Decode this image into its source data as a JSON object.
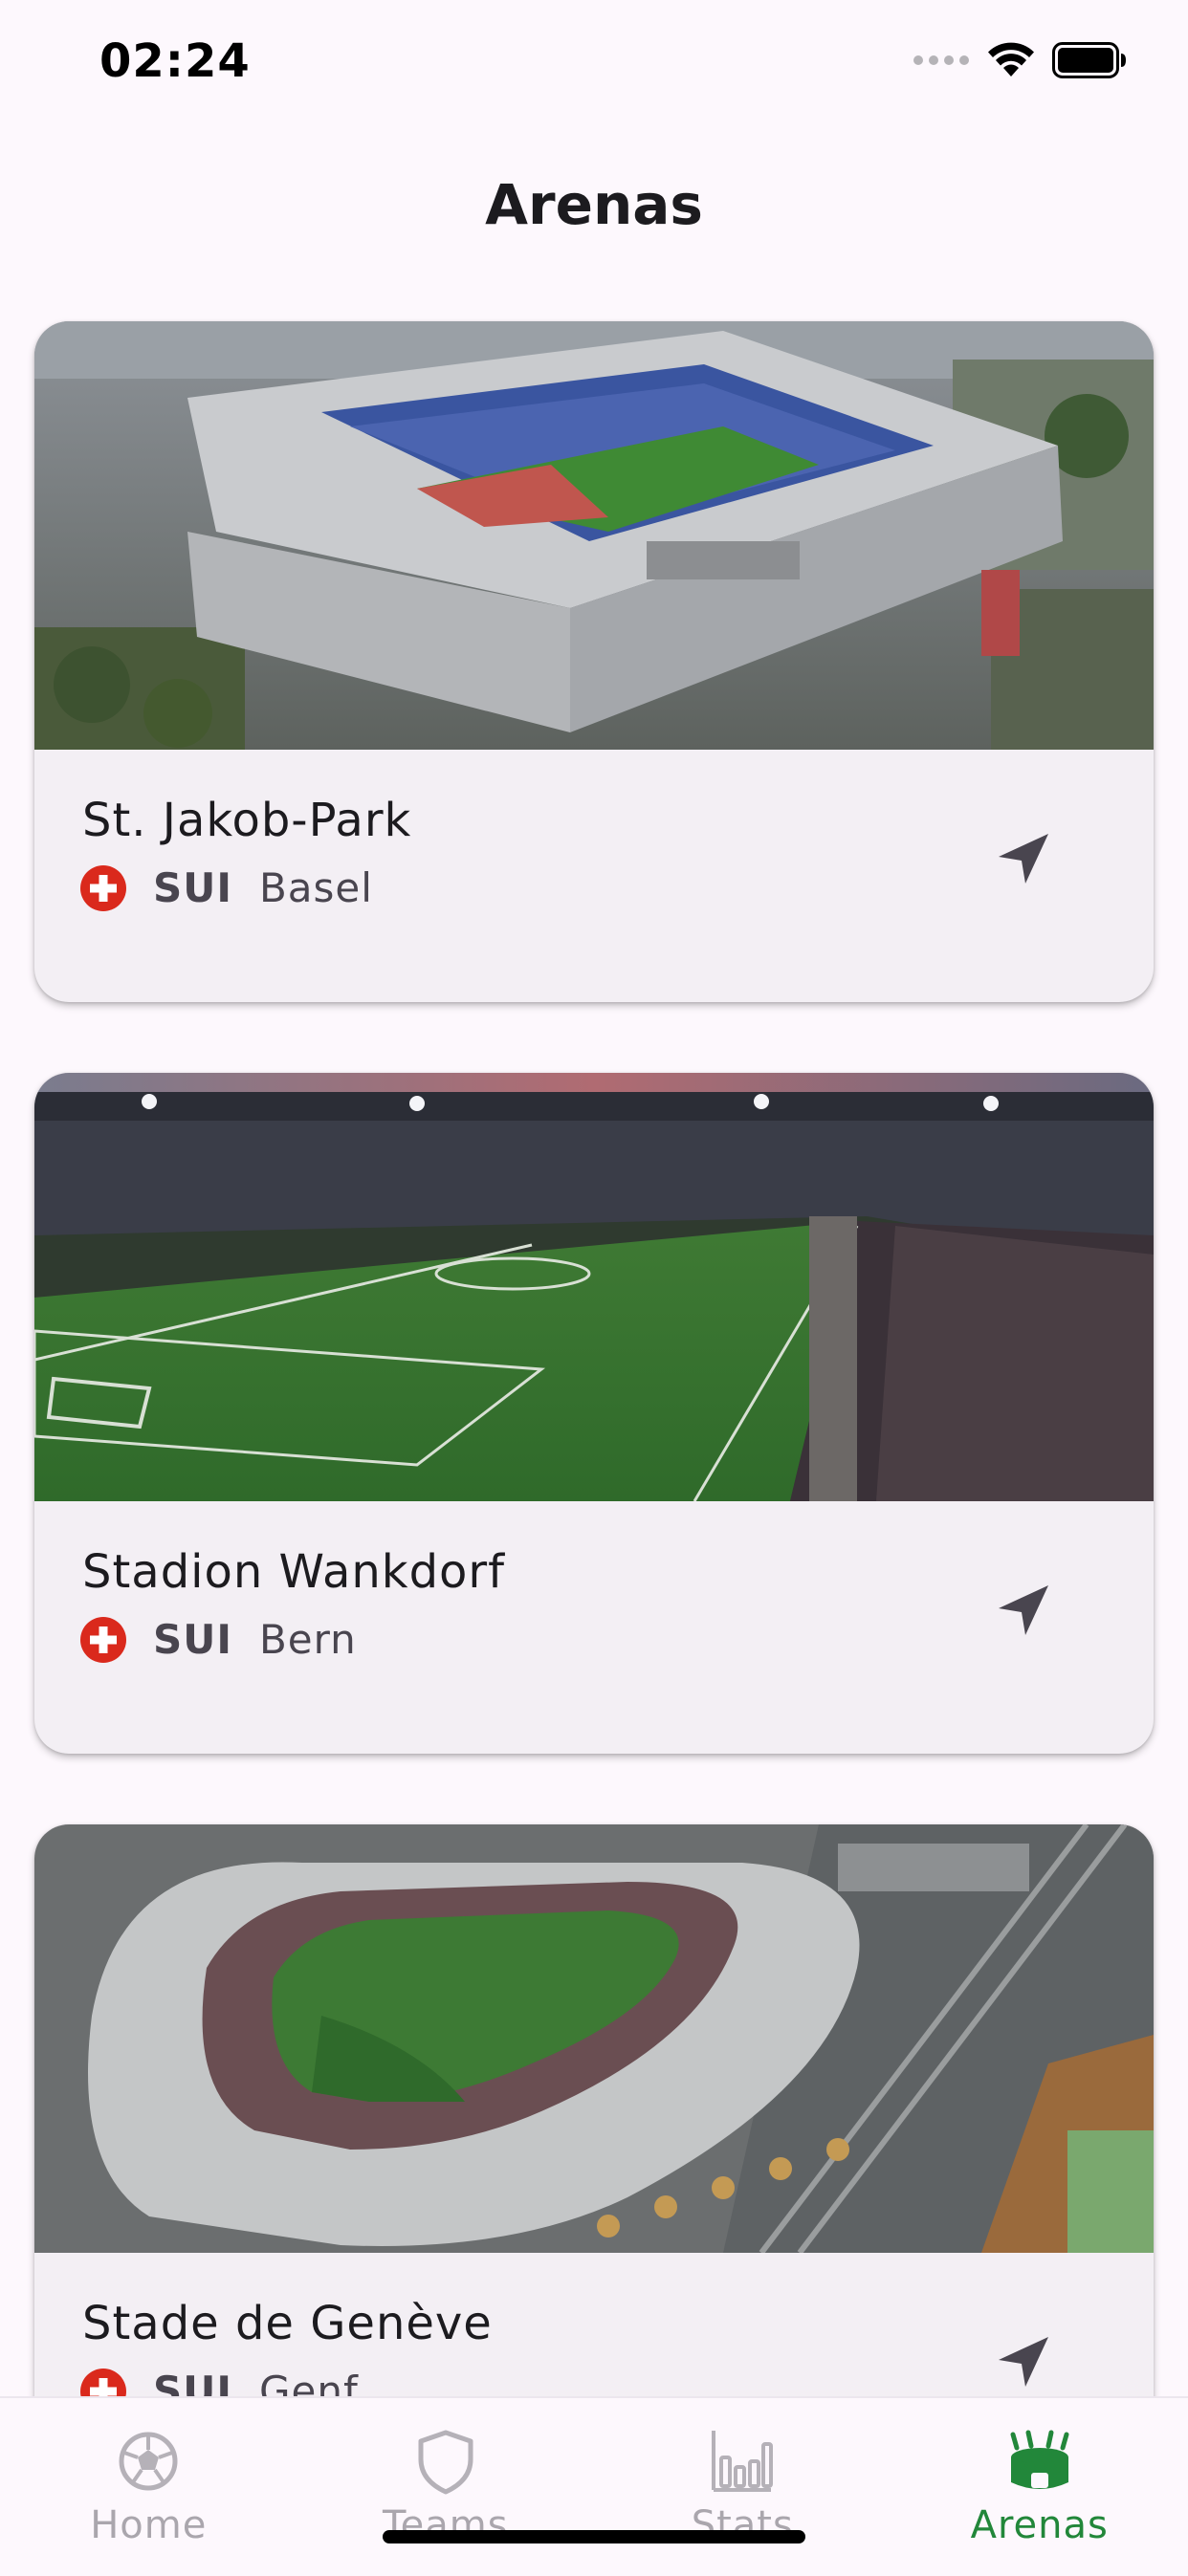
{
  "status_bar": {
    "time": "02:24"
  },
  "page": {
    "title": "Arenas"
  },
  "arenas": [
    {
      "name": "St. Jakob-Park",
      "country_code": "SUI",
      "city": "Basel",
      "flag_icon": "swiss-flag-icon",
      "action_icon": "navigation-arrow-icon"
    },
    {
      "name": "Stadion Wankdorf",
      "country_code": "SUI",
      "city": "Bern",
      "flag_icon": "swiss-flag-icon",
      "action_icon": "navigation-arrow-icon"
    },
    {
      "name": "Stade de Genève",
      "country_code": "SUI",
      "city": "Genf",
      "flag_icon": "swiss-flag-icon",
      "action_icon": "navigation-arrow-icon"
    }
  ],
  "bottom_nav": {
    "items": [
      {
        "label": "Home",
        "icon": "soccer-ball-icon",
        "active": false
      },
      {
        "label": "Teams",
        "icon": "shield-icon",
        "active": false
      },
      {
        "label": "Stats",
        "icon": "bar-chart-icon",
        "active": false
      },
      {
        "label": "Arenas",
        "icon": "stadium-icon",
        "active": true
      }
    ]
  },
  "colors": {
    "background": "#fdf8fd",
    "card": "#f3eff4",
    "accent_active": "#22873a",
    "inactive": "#aaa6ad",
    "flag_red": "#da291c"
  }
}
